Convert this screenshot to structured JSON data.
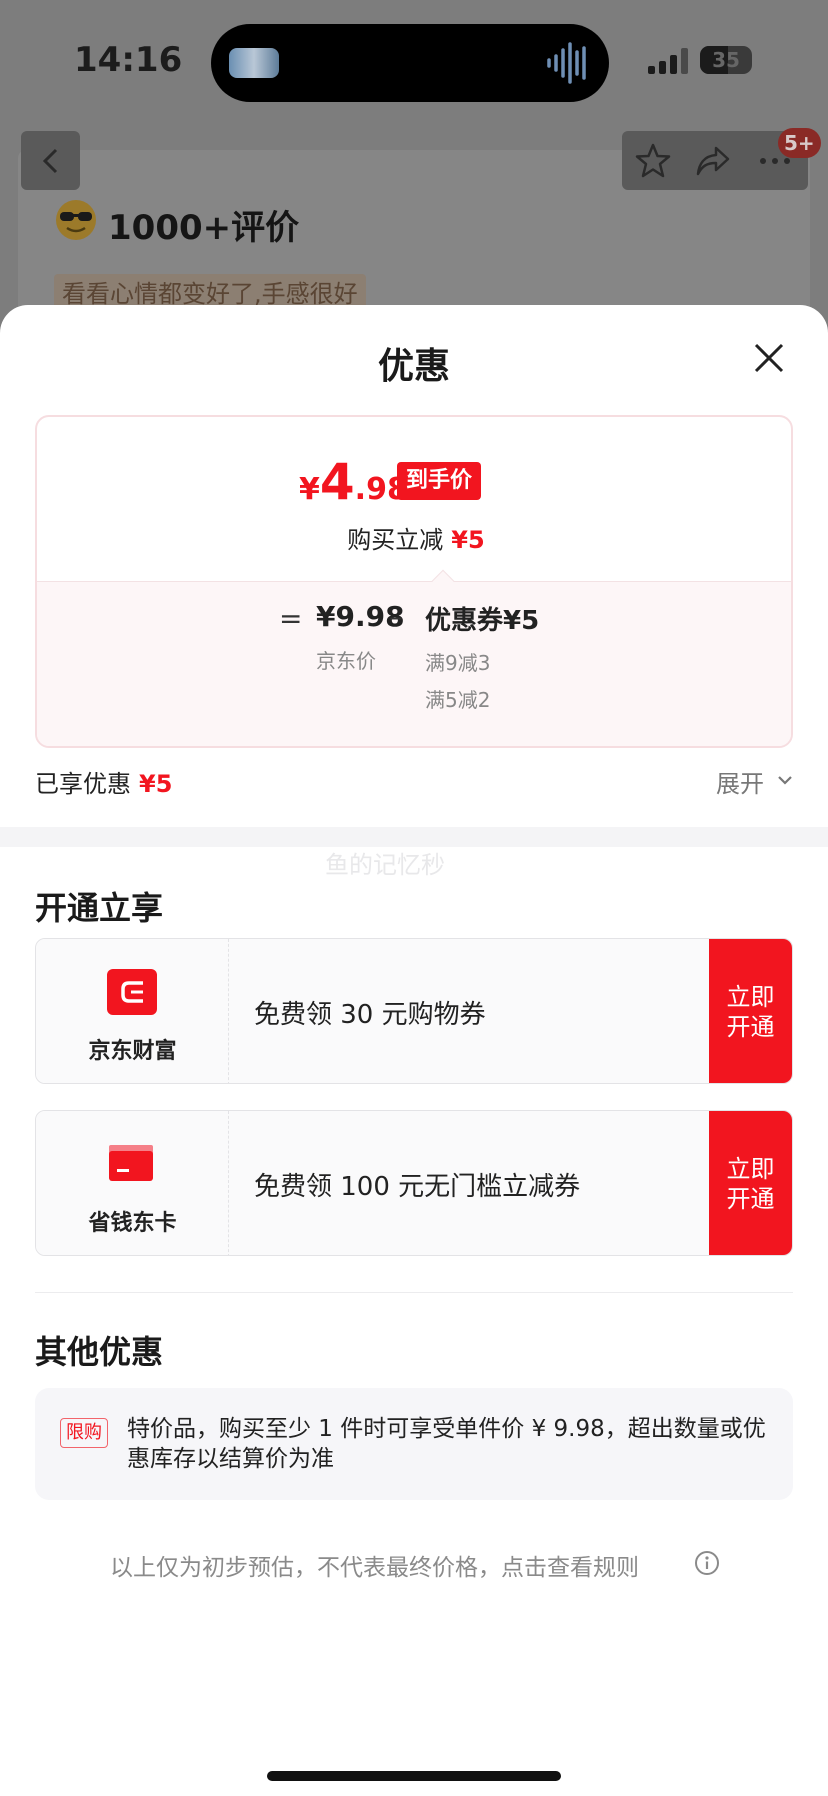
{
  "status_bar": {
    "time": "14:16",
    "battery": "35"
  },
  "background_page": {
    "message_badge": "5+",
    "review_count": "1000+评价",
    "review_snippet": "看看心情都变好了,手感很好"
  },
  "sheet": {
    "title": "优惠",
    "final_price": {
      "currency": "¥",
      "integer": "4",
      "decimal": ".98",
      "tag": "到手价"
    },
    "instant_discount": {
      "label": "购买立减",
      "amount": "¥5"
    },
    "breakdown": {
      "equals": "=",
      "jd_price": "¥9.98",
      "jd_price_label": "京东价",
      "minus": "–",
      "coupon": "优惠券¥5",
      "coupon_rules": [
        "满9减3",
        "满5减2"
      ]
    },
    "enjoyed": {
      "label": "已享优惠",
      "amount": "¥5"
    },
    "expand_label": "展开",
    "watermark": "鱼的记忆秒"
  },
  "open_benefits": {
    "title": "开通立享",
    "items": [
      {
        "name": "京东财富",
        "text": "免费领 30 元购物券",
        "button": "立即开通",
        "icon": "jd-wealth-icon"
      },
      {
        "name": "省钱东卡",
        "text": "免费领 100 元无门槛立减券",
        "button": "立即开通",
        "icon": "card-icon"
      }
    ]
  },
  "other": {
    "title": "其他优惠",
    "tag": "限购",
    "text": "特价品，购买至少 1 件时可享受单件价 ¥ 9.98，超出数量或优惠库存以结算价为准"
  },
  "footer_note": "以上仅为初步预估，不代表最终价格，点击查看规则",
  "colors": {
    "accent": "#f2151f",
    "card_border": "#f6dde0"
  }
}
